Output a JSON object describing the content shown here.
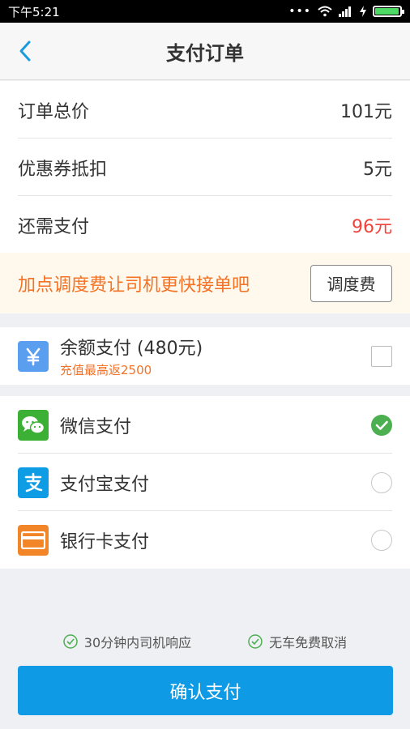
{
  "status_bar": {
    "time": "下午5:21",
    "dots": "•••"
  },
  "header": {
    "title": "支付订单"
  },
  "summary": {
    "rows": [
      {
        "label": "订单总价",
        "value": "101元"
      },
      {
        "label": "优惠券抵扣",
        "value": "5元"
      },
      {
        "label": "还需支付",
        "value": "96元"
      }
    ],
    "due_color": "#f0433b"
  },
  "promo": {
    "text": "加点调度费让司机更快接单吧",
    "button_label": "调度费"
  },
  "balance": {
    "icon": "yen-icon",
    "label": "余额支付 (480元)",
    "sub": "充值最高返2500",
    "checked": false
  },
  "payment_methods": [
    {
      "icon": "wechat-icon",
      "label": "微信支付",
      "selected": true
    },
    {
      "icon": "alipay-icon",
      "label": "支付宝支付",
      "selected": false
    },
    {
      "icon": "bank-card-icon",
      "label": "银行卡支付",
      "selected": false
    }
  ],
  "guarantees": [
    "30分钟内司机响应",
    "无车免费取消"
  ],
  "confirm_button": "确认支付",
  "colors": {
    "accent": "#0f9ae6",
    "orange": "#f37226",
    "wechat": "#3cb034",
    "alipay": "#0e9de5",
    "check_green": "#4caf50"
  }
}
